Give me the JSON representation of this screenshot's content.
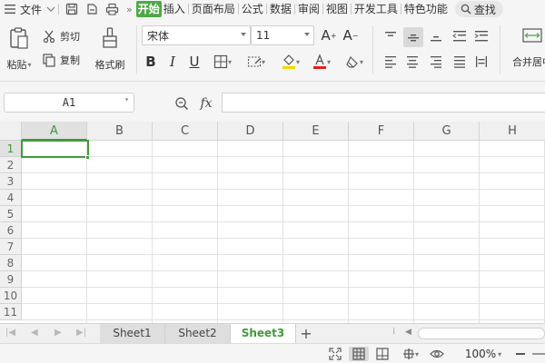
{
  "menubar": {
    "file_label": "文件",
    "tabs": [
      "开始",
      "插入",
      "页面布局",
      "公式",
      "数据",
      "审阅",
      "视图",
      "开发工具",
      "特色功能"
    ],
    "active_tab": "开始",
    "search_label": "查找"
  },
  "ribbon": {
    "paste_label": "粘贴",
    "cut_label": "剪切",
    "copy_label": "复制",
    "format_painter_label": "格式刷",
    "font_name": "宋体",
    "font_size": "11",
    "merge_center_label": "合并居中",
    "font_color": "#e02020",
    "fill_color": "#f5d800"
  },
  "formula_bar": {
    "cell_reference": "A1",
    "fx_label": "fx",
    "formula_value": ""
  },
  "grid": {
    "columns": [
      "A",
      "B",
      "C",
      "D",
      "E",
      "F",
      "G",
      "H"
    ],
    "rows": [
      "1",
      "2",
      "3",
      "4",
      "5",
      "6",
      "7",
      "8",
      "9",
      "10",
      "11"
    ],
    "selected_cell": "A1"
  },
  "sheets": {
    "tabs": [
      "Sheet1",
      "Sheet2",
      "Sheet3"
    ],
    "active": "Sheet3",
    "add_label": "+"
  },
  "statusbar": {
    "zoom": "100%"
  },
  "colors": {
    "accent": "#3f9a3a",
    "tab_active_bg": "#4fa847"
  }
}
